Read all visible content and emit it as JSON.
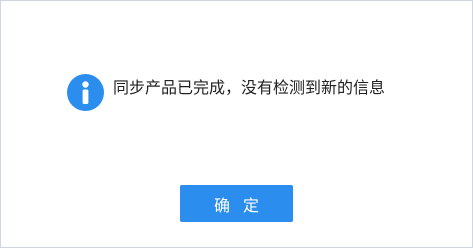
{
  "dialog": {
    "message": "同步产品已完成，没有检测到新的信息",
    "icon": "info-icon",
    "ok_label": "确 定"
  },
  "colors": {
    "accent": "#2b8ded",
    "border": "#cfd6df",
    "text": "#222222"
  }
}
